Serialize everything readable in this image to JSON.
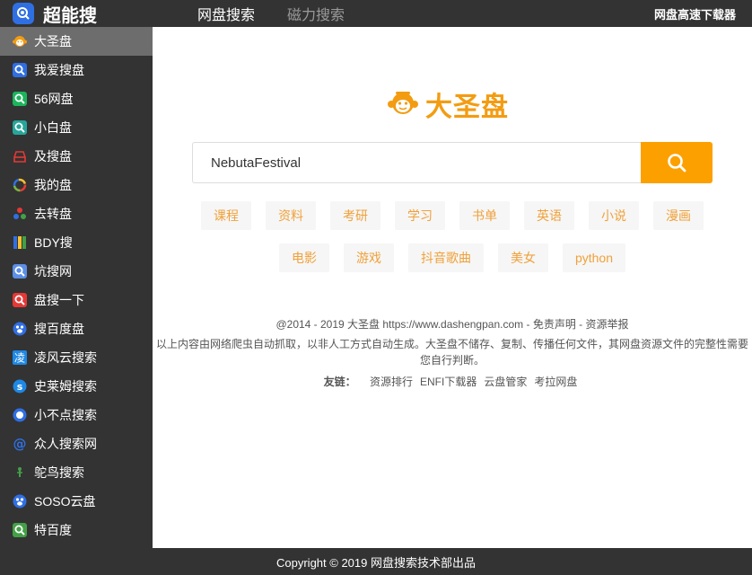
{
  "brand": {
    "name": "超能搜"
  },
  "topnav": [
    {
      "label": "网盘搜索"
    },
    {
      "label": "磁力搜索"
    }
  ],
  "top_right": "网盘高速下载器",
  "sidebar": {
    "items": [
      {
        "label": "大圣盘",
        "icon": "monkey-icon",
        "color": "#f39c12"
      },
      {
        "label": "我爱搜盘",
        "icon": "search-icon",
        "color": "#2f6fe3"
      },
      {
        "label": "56网盘",
        "icon": "search-icon",
        "color": "#1bb55c"
      },
      {
        "label": "小白盘",
        "icon": "search-icon",
        "color": "#26a69a"
      },
      {
        "label": "及搜盘",
        "icon": "tray-icon",
        "color": "#e53935"
      },
      {
        "label": "我的盘",
        "icon": "ring-icon",
        "color": "#7cb342"
      },
      {
        "label": "去转盘",
        "icon": "dots-icon",
        "color": "#e53935"
      },
      {
        "label": "BDY搜",
        "icon": "stripes-icon",
        "color": "#fbc02d"
      },
      {
        "label": "坑搜网",
        "icon": "search-icon",
        "color": "#5c8fe6"
      },
      {
        "label": "盘搜一下",
        "icon": "search-icon",
        "color": "#e53935"
      },
      {
        "label": "搜百度盘",
        "icon": "paw-icon",
        "color": "#2f6fe3"
      },
      {
        "label": "凌风云搜索",
        "icon": "ling-icon",
        "color": "#1e88e5"
      },
      {
        "label": "史莱姆搜索",
        "icon": "slime-icon",
        "color": "#1e88e5"
      },
      {
        "label": "小不点搜索",
        "icon": "dot-icon",
        "color": "#2f6fe3"
      },
      {
        "label": "众人搜索网",
        "icon": "at-icon",
        "color": "#2f6fe3"
      },
      {
        "label": "鸵鸟搜索",
        "icon": "ostrich-icon",
        "color": "#43a047"
      },
      {
        "label": "SOSO云盘",
        "icon": "paw-icon",
        "color": "#2f6fe3"
      },
      {
        "label": "特百度",
        "icon": "search-icon",
        "color": "#43a047"
      }
    ]
  },
  "main": {
    "logo_text": "大圣盘",
    "search_value": "NebutaFestival",
    "tags_row1": [
      "课程",
      "资料",
      "考研",
      "学习",
      "书单",
      "英语",
      "小说",
      "漫画"
    ],
    "tags_row2": [
      "电影",
      "游戏",
      "抖音歌曲",
      "美女",
      "python"
    ],
    "copyright": "@2014 - 2019 大圣盘 https://www.dashengpan.com",
    "disclaimer_link": "免责声明",
    "report_link": "资源举报",
    "sep": " - ",
    "disclaimer": "以上内容由网络爬虫自动抓取，以非人工方式自动生成。大圣盘不储存、复制、传播任何文件，其网盘资源文件的完整性需要您自行判断。",
    "friends_label": "友链：",
    "friends": [
      "资源排行",
      "ENFI下载器",
      "云盘管家",
      "考拉网盘"
    ]
  },
  "bottom": "Copyright © 2019 网盘搜索技术部出品",
  "accent": "#fca000"
}
